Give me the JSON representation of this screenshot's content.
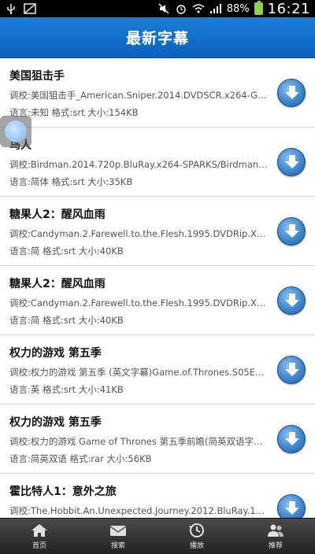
{
  "status_bar": {
    "battery": "88%",
    "time": "16:21"
  },
  "header": {
    "title": "最新字幕"
  },
  "subtitles": [
    {
      "title": "美国狙击手",
      "file": "调校:美国狙击手_American.Sniper.2014.DVDSCR.x264-GoP...",
      "meta": "语言:未知 格式:srt 大小:154KB"
    },
    {
      "title": "鸟人",
      "file": "调校:Birdman.2014.720p.BluRay.x264-SPARKS/Birdman.20...",
      "meta": "语言:简体 格式:srt 大小:35KB"
    },
    {
      "title": "糖果人2：醒风血雨",
      "file": "调校:Candyman.2.Farewell.to.the.Flesh.1995.DVDRip.XviD...",
      "meta": "语言:简 格式:srt 大小:40KB"
    },
    {
      "title": "糖果人2：醒风血雨",
      "file": "调校:Candyman.2.Farewell.to.the.Flesh.1995.DVDRip.XviD...",
      "meta": "语言:简 格式:srt 大小:40KB"
    },
    {
      "title": "权力的游戏 第五季",
      "file": "调校:权力的游戏 第五季 (英文字幕)Game.of.Thrones.S05E00...",
      "meta": "语言:英 格式:srt 大小:41KB"
    },
    {
      "title": "权力的游戏 第五季",
      "file": "调校:权力的游戏 Game of Thrones 第五季前瞻(简英双语字幕...",
      "meta": "语言:简英双语 格式:rar 大小:56KB"
    },
    {
      "title": "霍比特人1：意外之旅",
      "file": "调校:The.Hobbit.An.Unexpected.Journey.2012.BluRay.1080...",
      "meta": ""
    }
  ],
  "bottom_nav": {
    "items": [
      {
        "label": "首页",
        "icon": "home-icon"
      },
      {
        "label": "搜索",
        "icon": "mail-icon"
      },
      {
        "label": "播放",
        "icon": "history-icon"
      },
      {
        "label": "推荐",
        "icon": "users-icon"
      }
    ]
  }
}
